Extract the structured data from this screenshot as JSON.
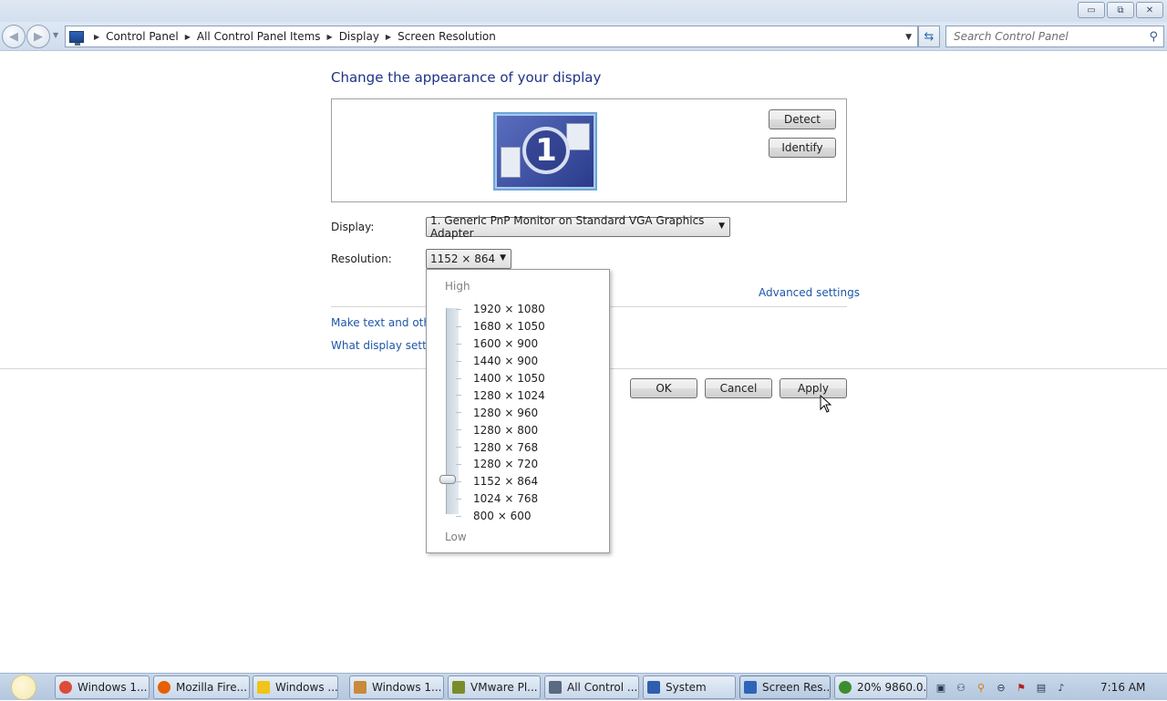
{
  "window": {
    "caption_buttons": {
      "minimize": "▭",
      "maximize": "⧉",
      "close": "✕"
    }
  },
  "nav": {
    "breadcrumbs": [
      "Control Panel",
      "All Control Panel Items",
      "Display",
      "Screen Resolution"
    ],
    "search_placeholder": "Search Control Panel"
  },
  "main": {
    "title": "Change the appearance of your display",
    "monitor_number": "1",
    "detect_label": "Detect",
    "identify_label": "Identify",
    "display_label": "Display:",
    "display_value": "1. Generic PnP Monitor on Standard VGA Graphics Adapter",
    "resolution_label": "Resolution:",
    "resolution_value": "1152 × 864",
    "advanced_link": "Advanced settings",
    "link_text_size": "Make text and other",
    "link_display_settings": "What display setting",
    "ok_label": "OK",
    "cancel_label": "Cancel",
    "apply_label": "Apply"
  },
  "resolution_dropdown": {
    "high_label": "High",
    "low_label": "Low",
    "options": [
      "1920 × 1080",
      "1680 × 1050",
      "1600 × 900",
      "1440 × 900",
      "1400 × 1050",
      "1280 × 1024",
      "1280 × 960",
      "1280 × 800",
      "1280 × 768",
      "1280 × 720",
      "1152 × 864",
      "1024 × 768",
      "800 × 600"
    ],
    "selected": "1152 × 864"
  },
  "taskbar": {
    "items": [
      {
        "label": "Windows 1...",
        "icon": "chrome-icon",
        "color": "#dd4b39"
      },
      {
        "label": "Mozilla Fire...",
        "icon": "firefox-icon",
        "color": "#e66000"
      },
      {
        "label": "Windows ...",
        "icon": "windows-folder-icon",
        "color": "#f0c419"
      },
      {
        "label": "Windows 1...",
        "icon": "window-app-icon",
        "color": "#c98a3a"
      },
      {
        "label": "VMware Pl...",
        "icon": "vmware-icon",
        "color": "#7a8c2a"
      },
      {
        "label": "All Control ...",
        "icon": "control-panel-icon",
        "color": "#5a6a80"
      },
      {
        "label": "System",
        "icon": "system-icon",
        "color": "#2e5fae"
      },
      {
        "label": "Screen Res...",
        "icon": "display-icon",
        "color": "#2e64b8"
      },
      {
        "label": "20% 9860.0...",
        "icon": "download-icon",
        "color": "#3c8d2f"
      }
    ],
    "clock": "7:16 AM"
  }
}
